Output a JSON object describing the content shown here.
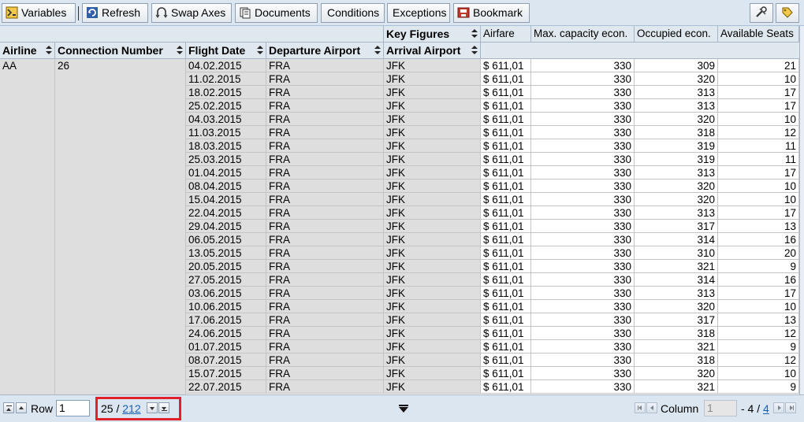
{
  "toolbar": {
    "buttons": [
      {
        "label": "Variables",
        "icon": "variables-icon"
      },
      {
        "label": "Refresh",
        "icon": "refresh-icon"
      },
      {
        "label": "Swap Axes",
        "icon": "swap-axes-icon"
      },
      {
        "label": "Documents",
        "icon": "documents-icon"
      },
      {
        "label": "Conditions",
        "icon": ""
      },
      {
        "label": "Exceptions",
        "icon": ""
      },
      {
        "label": "Bookmark",
        "icon": "bookmark-icon"
      }
    ],
    "right_icons": [
      "tools-icon",
      "tag-icon"
    ]
  },
  "grid": {
    "key_figures_label": "Key Figures",
    "dimension_headers": [
      "Airline",
      "Connection Number",
      "Flight Date",
      "Departure Airport",
      "Arrival Airport"
    ],
    "measure_headers": [
      "Airfare",
      "Max. capacity econ.",
      "Occupied econ.",
      "Available Seats"
    ],
    "airline": "AA",
    "connection_number": "26",
    "rows": [
      [
        "04.02.2015",
        "FRA",
        "JFK",
        "$ 611,01",
        "330",
        "309",
        "21"
      ],
      [
        "11.02.2015",
        "FRA",
        "JFK",
        "$ 611,01",
        "330",
        "320",
        "10"
      ],
      [
        "18.02.2015",
        "FRA",
        "JFK",
        "$ 611,01",
        "330",
        "313",
        "17"
      ],
      [
        "25.02.2015",
        "FRA",
        "JFK",
        "$ 611,01",
        "330",
        "313",
        "17"
      ],
      [
        "04.03.2015",
        "FRA",
        "JFK",
        "$ 611,01",
        "330",
        "320",
        "10"
      ],
      [
        "11.03.2015",
        "FRA",
        "JFK",
        "$ 611,01",
        "330",
        "318",
        "12"
      ],
      [
        "18.03.2015",
        "FRA",
        "JFK",
        "$ 611,01",
        "330",
        "319",
        "11"
      ],
      [
        "25.03.2015",
        "FRA",
        "JFK",
        "$ 611,01",
        "330",
        "319",
        "11"
      ],
      [
        "01.04.2015",
        "FRA",
        "JFK",
        "$ 611,01",
        "330",
        "313",
        "17"
      ],
      [
        "08.04.2015",
        "FRA",
        "JFK",
        "$ 611,01",
        "330",
        "320",
        "10"
      ],
      [
        "15.04.2015",
        "FRA",
        "JFK",
        "$ 611,01",
        "330",
        "320",
        "10"
      ],
      [
        "22.04.2015",
        "FRA",
        "JFK",
        "$ 611,01",
        "330",
        "313",
        "17"
      ],
      [
        "29.04.2015",
        "FRA",
        "JFK",
        "$ 611,01",
        "330",
        "317",
        "13"
      ],
      [
        "06.05.2015",
        "FRA",
        "JFK",
        "$ 611,01",
        "330",
        "314",
        "16"
      ],
      [
        "13.05.2015",
        "FRA",
        "JFK",
        "$ 611,01",
        "330",
        "310",
        "20"
      ],
      [
        "20.05.2015",
        "FRA",
        "JFK",
        "$ 611,01",
        "330",
        "321",
        "9"
      ],
      [
        "27.05.2015",
        "FRA",
        "JFK",
        "$ 611,01",
        "330",
        "314",
        "16"
      ],
      [
        "03.06.2015",
        "FRA",
        "JFK",
        "$ 611,01",
        "330",
        "313",
        "17"
      ],
      [
        "10.06.2015",
        "FRA",
        "JFK",
        "$ 611,01",
        "330",
        "320",
        "10"
      ],
      [
        "17.06.2015",
        "FRA",
        "JFK",
        "$ 611,01",
        "330",
        "317",
        "13"
      ],
      [
        "24.06.2015",
        "FRA",
        "JFK",
        "$ 611,01",
        "330",
        "318",
        "12"
      ],
      [
        "01.07.2015",
        "FRA",
        "JFK",
        "$ 611,01",
        "330",
        "321",
        "9"
      ],
      [
        "08.07.2015",
        "FRA",
        "JFK",
        "$ 611,01",
        "330",
        "318",
        "12"
      ],
      [
        "15.07.2015",
        "FRA",
        "JFK",
        "$ 611,01",
        "330",
        "320",
        "10"
      ],
      [
        "22.07.2015",
        "FRA",
        "JFK",
        "$ 611,01",
        "330",
        "321",
        "9"
      ]
    ]
  },
  "footer": {
    "row_label": "Row",
    "row_value": "1",
    "rows_visible": "25",
    "rows_separator": "/",
    "rows_total": "212",
    "column_label": "Column",
    "column_value": "1",
    "column_separator": "- 4 /",
    "columns_total": "4"
  },
  "colors": {
    "toolbar_bg": "#dbe6f1",
    "header_bg": "#dfe7ef",
    "dimension_cell_bg": "#dedede",
    "highlight_border": "#e0202a",
    "link": "#1a5fb4"
  }
}
